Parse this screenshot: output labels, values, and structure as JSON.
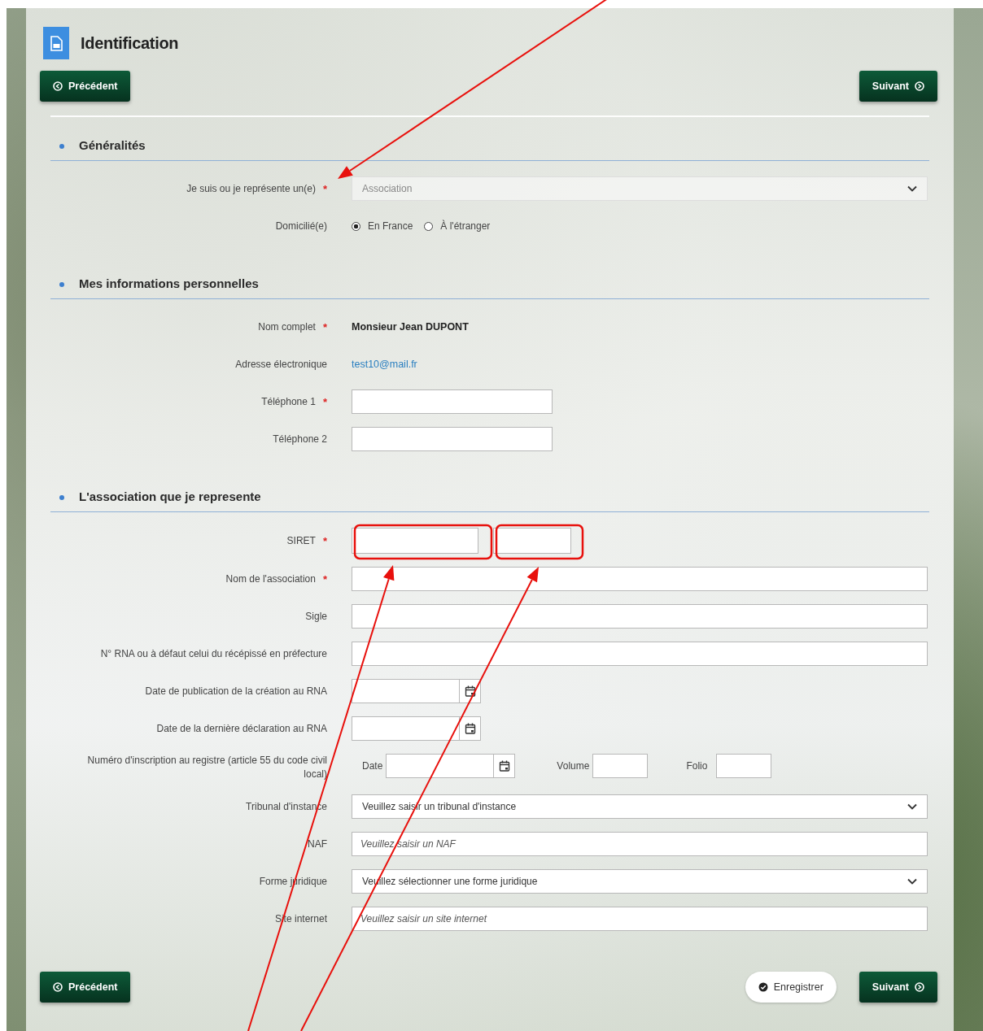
{
  "page": {
    "title": "Identification"
  },
  "nav_top": {
    "previous": "Précédent",
    "next": "Suivant"
  },
  "sections": [
    {
      "title": "Généralités",
      "rows": [
        {
          "kind": "select",
          "label": "Je suis ou je représente un(e)",
          "required_mark": "*",
          "value": "Association",
          "disabled": true
        },
        {
          "kind": "radio",
          "label": "Domicilié(e)",
          "options": [
            {
              "label": "En France",
              "selected": true
            },
            {
              "label": "À l'étranger",
              "selected": false
            }
          ]
        }
      ]
    },
    {
      "title": "Mes informations personnelles",
      "rows": [
        {
          "kind": "static",
          "label": "Nom complet",
          "required_mark": "*",
          "value": "Monsieur Jean DUPONT"
        },
        {
          "kind": "email",
          "label": "Adresse électronique",
          "value": "test10@mail.fr"
        },
        {
          "kind": "short_text",
          "label": "Téléphone 1",
          "required_mark": "*"
        },
        {
          "kind": "short_text",
          "label": "Téléphone 2"
        }
      ]
    },
    {
      "title": "L'association que je represente",
      "rows": [
        {
          "kind": "siret",
          "label": "SIRET",
          "required_mark": "*"
        },
        {
          "kind": "text",
          "label": "Nom de l'association",
          "required_mark": "*"
        },
        {
          "kind": "text",
          "label": "Sigle"
        },
        {
          "kind": "text",
          "label": "N° RNA ou à défaut celui du récépissé en préfecture"
        },
        {
          "kind": "date",
          "label": "Date de publication de la création au RNA"
        },
        {
          "kind": "date",
          "label": "Date de la dernière déclaration au RNA"
        },
        {
          "kind": "registre",
          "label": "Numéro d'inscription au registre (article 55 du code civil local)",
          "parts": [
            {
              "kind": "date",
              "label": "Date"
            },
            {
              "kind": "text",
              "label": "Volume"
            },
            {
              "kind": "text",
              "label": "Folio"
            }
          ]
        },
        {
          "kind": "select",
          "label": "Tribunal d'instance",
          "value": "Veuillez saisir un tribunal d'instance",
          "disabled": false
        },
        {
          "kind": "text",
          "label": "NAF",
          "placeholder": "Veuillez saisir un NAF"
        },
        {
          "kind": "select",
          "label": "Forme juridique",
          "value": "Veuillez sélectionner une forme juridique",
          "disabled": false
        },
        {
          "kind": "text",
          "label": "Site internet",
          "placeholder": "Veuillez saisir un site internet"
        }
      ]
    }
  ],
  "nav_bottom": {
    "previous": "Précédent",
    "save": "Enregistrer",
    "next": "Suivant"
  }
}
